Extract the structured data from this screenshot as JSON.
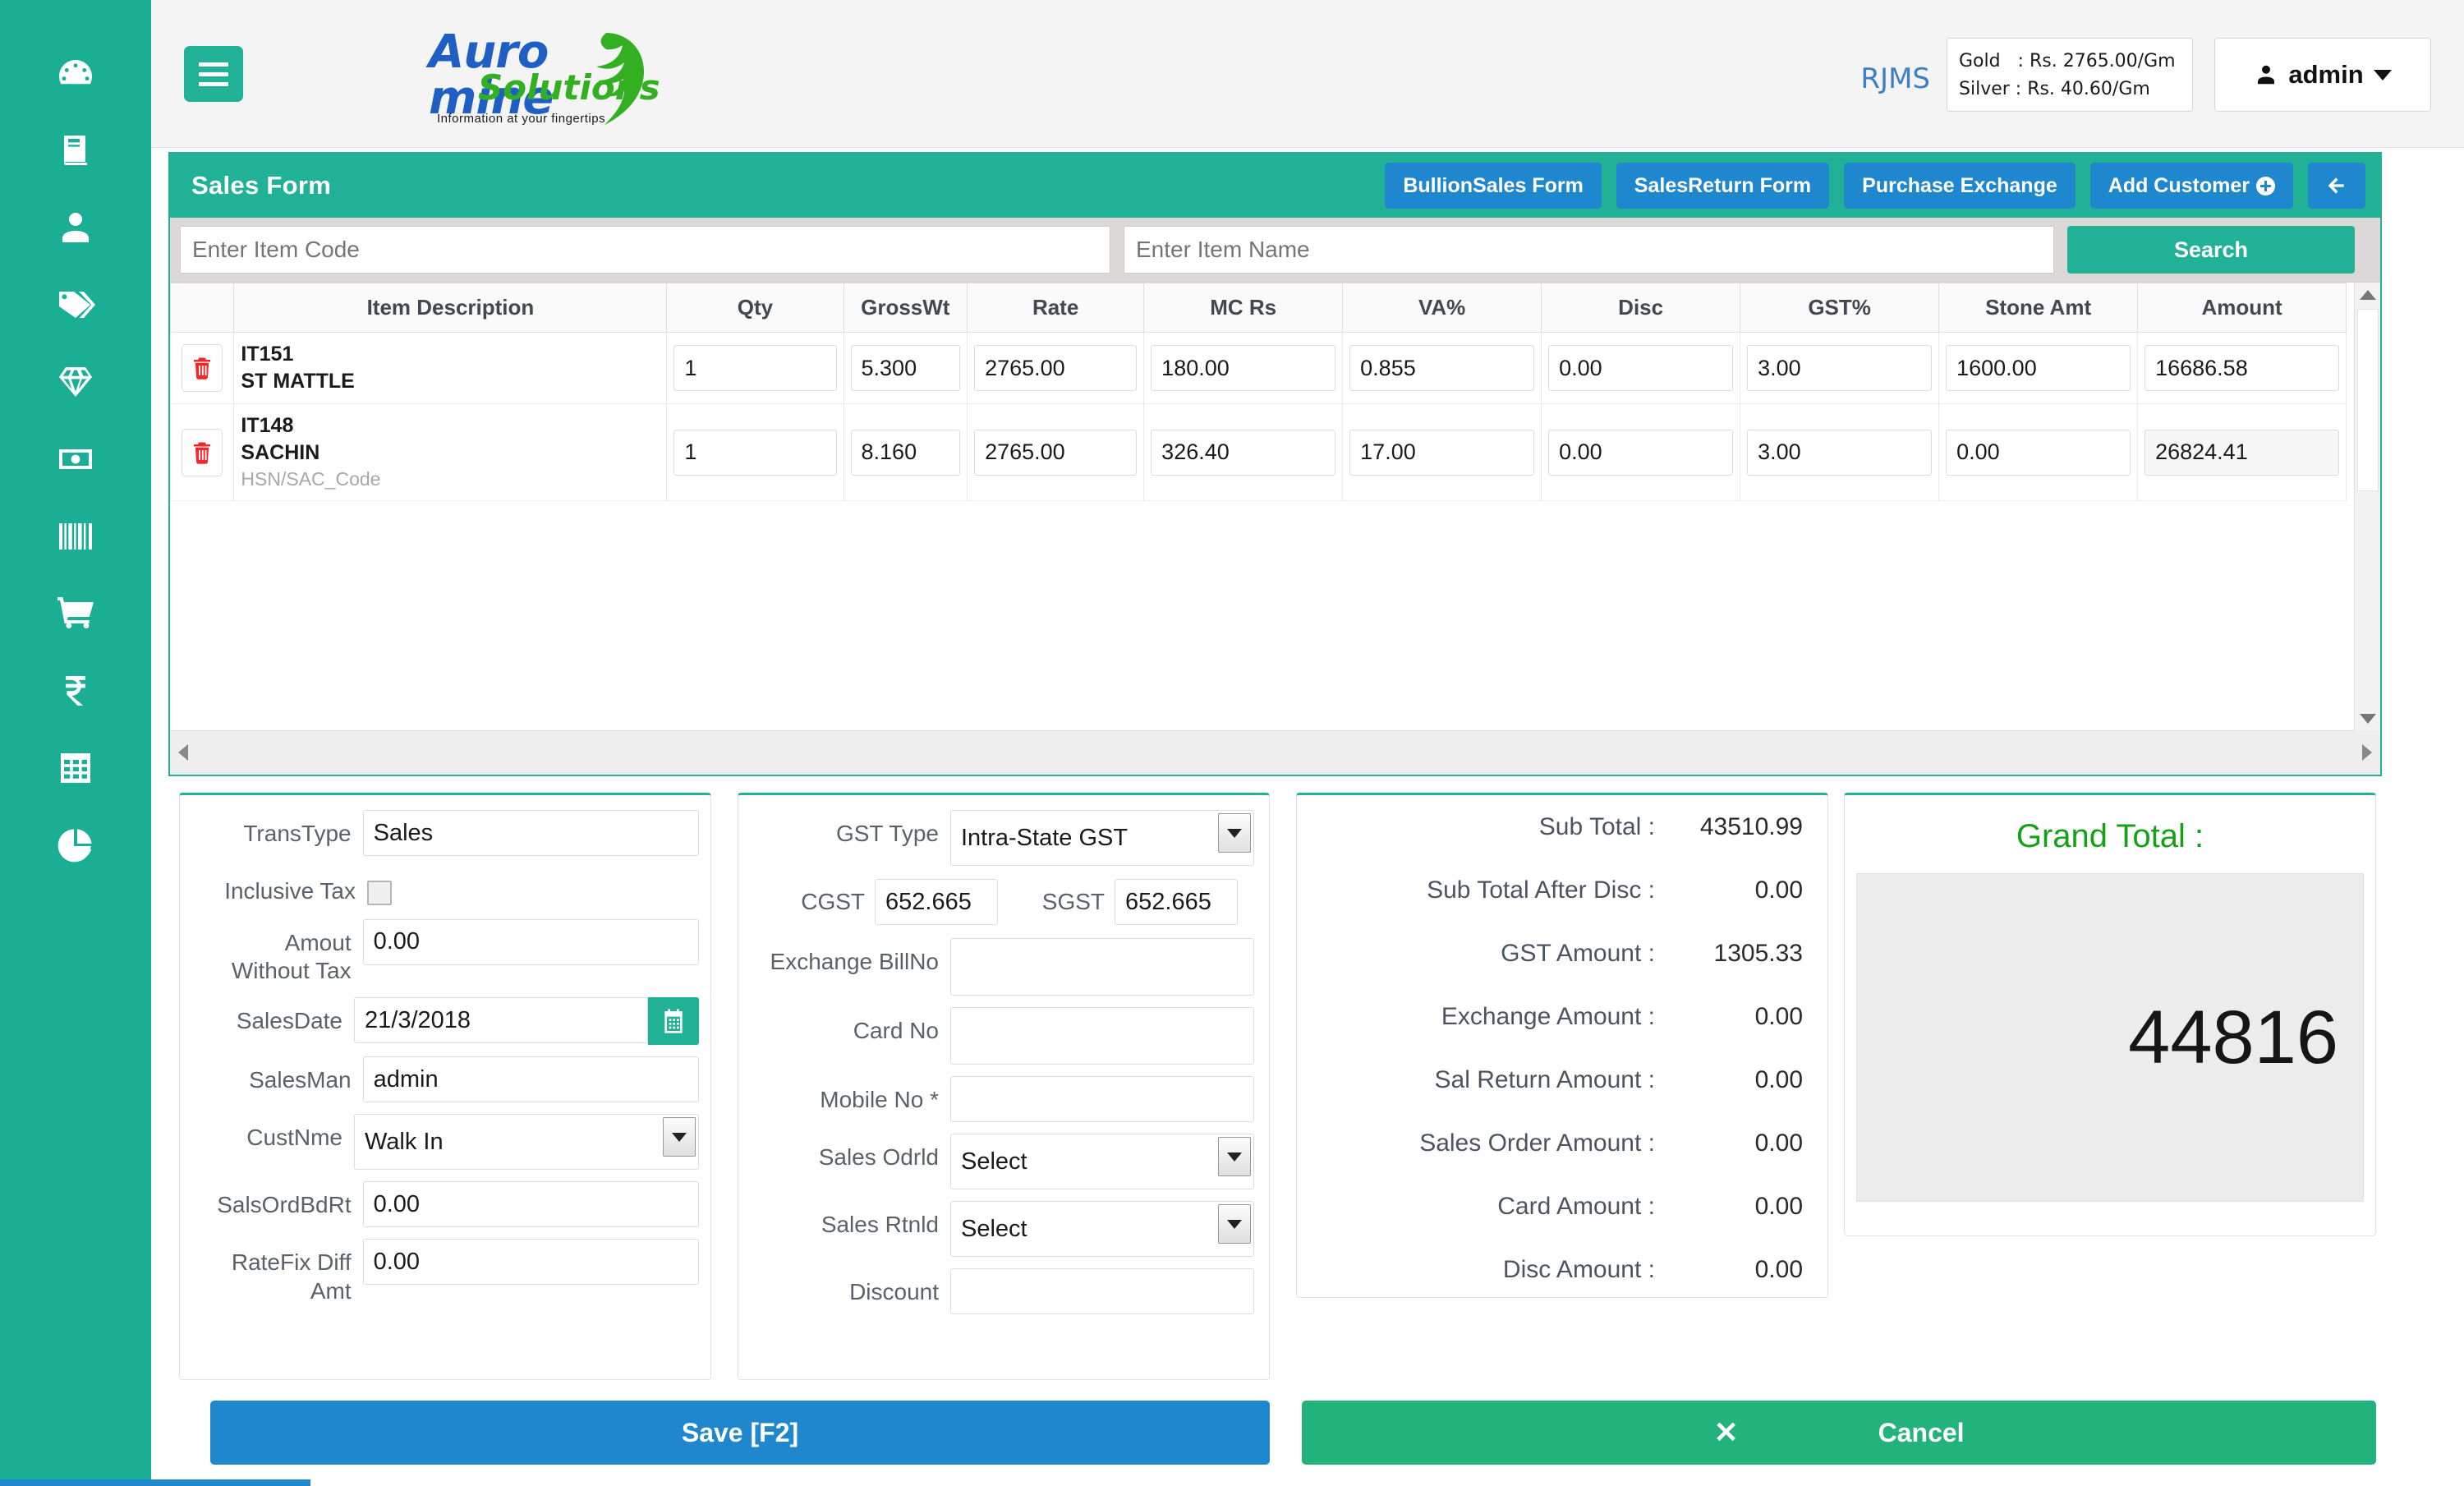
{
  "sidebar": {
    "items": [
      {
        "icon": "dashboard-icon",
        "name": "dashboard"
      },
      {
        "icon": "book-icon",
        "name": "daybook"
      },
      {
        "icon": "user-icon",
        "name": "customers"
      },
      {
        "icon": "tags-icon",
        "name": "tags"
      },
      {
        "icon": "gem-icon",
        "name": "jewellery"
      },
      {
        "icon": "money-bill-icon",
        "name": "cash"
      },
      {
        "icon": "barcode-icon",
        "name": "barcode"
      },
      {
        "icon": "shopping-cart-icon",
        "name": "sales"
      },
      {
        "icon": "rupee-icon",
        "name": "accounts"
      },
      {
        "icon": "grid-table-icon",
        "name": "reports-table"
      },
      {
        "icon": "pie-chart-icon",
        "name": "analytics"
      }
    ]
  },
  "topbar": {
    "logo_primary": "Auro mine",
    "logo_secondary": "Solutions",
    "logo_tagline": "Information at your fingertips",
    "app_code": "RJMS",
    "rates_text": "Gold   : Rs. 2765.00/Gm\nSilver : Rs. 40.60/Gm",
    "gold_rate": "Gold   : Rs. 2765.00/Gm",
    "silver_rate": "Silver : Rs. 40.60/Gm",
    "user_name": "admin"
  },
  "panel": {
    "title": "Sales Form",
    "actions": [
      {
        "label": "BullionSales Form"
      },
      {
        "label": "SalesReturn Form"
      },
      {
        "label": "Purchase Exchange"
      },
      {
        "label": "Add Customer"
      }
    ],
    "back_label": ""
  },
  "search": {
    "item_code_placeholder": "Enter Item Code",
    "item_code_value": "",
    "item_name_placeholder": "Enter Item Name",
    "item_name_value": "",
    "search_label": "Search"
  },
  "grid": {
    "columns": [
      "",
      "Item Description",
      "Qty",
      "GrossWt",
      "Rate",
      "MC Rs",
      "VA%",
      "Disc",
      "GST%",
      "Stone Amt",
      "Amount"
    ],
    "rows": [
      {
        "code": "IT151",
        "name": "ST MATTLE",
        "hsn": "",
        "qty": "1",
        "grosswt": "5.300",
        "rate": "2765.00",
        "mc": "180.00",
        "va": "0.855",
        "disc": "0.00",
        "gst": "3.00",
        "stone": "1600.00",
        "amount": "16686.58"
      },
      {
        "code": "IT148",
        "name": "SACHIN",
        "hsn": "HSN/SAC_Code",
        "qty": "1",
        "grosswt": "8.160",
        "rate": "2765.00",
        "mc": "326.40",
        "va": "17.00",
        "disc": "0.00",
        "gst": "3.00",
        "stone": "0.00",
        "amount": "26824.41"
      }
    ]
  },
  "form_left": {
    "transtype_label": "TransType",
    "transtype_value": "Sales",
    "inclusive_tax_label": "Inclusive Tax",
    "inclusive_tax_checked": false,
    "amount_without_tax_label": "Amout\nWithout Tax",
    "amount_without_tax_l1": "Amout",
    "amount_without_tax_l2": "Without Tax",
    "amount_without_tax_value": "0.00",
    "salesdate_label": "SalesDate",
    "salesdate_value": "21/3/2018",
    "salesman_label": "SalesMan",
    "salesman_value": "admin",
    "custnme_label": "CustNme",
    "custnme_value": "Walk In",
    "salsordbdrt_label": "SalsOrdBdRt",
    "salsordbdrt_value": "0.00",
    "ratefix_l1": "RateFix Diff",
    "ratefix_l2": "Amt",
    "ratefix_value": "0.00"
  },
  "form_mid": {
    "gsttype_label": "GST Type",
    "gsttype_value": "Intra-State GST",
    "cgst_label": "CGST",
    "cgst_value": "652.665",
    "sgst_label": "SGST",
    "sgst_value": "652.665",
    "exchange_billno_label": "Exchange BillNo",
    "exchange_billno_value": "",
    "card_no_label": "Card No",
    "card_no_value": "",
    "mobile_no_label": "Mobile No *",
    "mobile_no_value": "",
    "sales_odrid_label": "Sales Odrld",
    "sales_odrid_value": "Select",
    "sales_rtnid_label": "Sales Rtnld",
    "sales_rtnid_value": "Select",
    "discount_label": "Discount",
    "discount_value": ""
  },
  "totals": {
    "rows": [
      {
        "label": "Sub Total :",
        "value": "43510.99"
      },
      {
        "label": "Sub Total After Disc :",
        "value": "0.00"
      },
      {
        "label": "GST Amount :",
        "value": "1305.33"
      },
      {
        "label": "Exchange Amount :",
        "value": "0.00"
      },
      {
        "label": "Sal Return Amount :",
        "value": "0.00"
      },
      {
        "label": "Sales Order Amount :",
        "value": "0.00"
      },
      {
        "label": "Card Amount :",
        "value": "0.00"
      },
      {
        "label": "Disc Amount :",
        "value": "0.00"
      }
    ]
  },
  "grand_total": {
    "title": "Grand Total :",
    "value": "44816"
  },
  "footer": {
    "save_label": "Save [F2]",
    "cancel_label": "Cancel",
    "cancel_icon": "✕"
  },
  "colors": {
    "brand_green": "#21b196",
    "sidebar_green": "#1aae94",
    "action_blue": "#1e87cd",
    "grand_total_green": "#15a116",
    "delete_red": "#f5252a"
  }
}
